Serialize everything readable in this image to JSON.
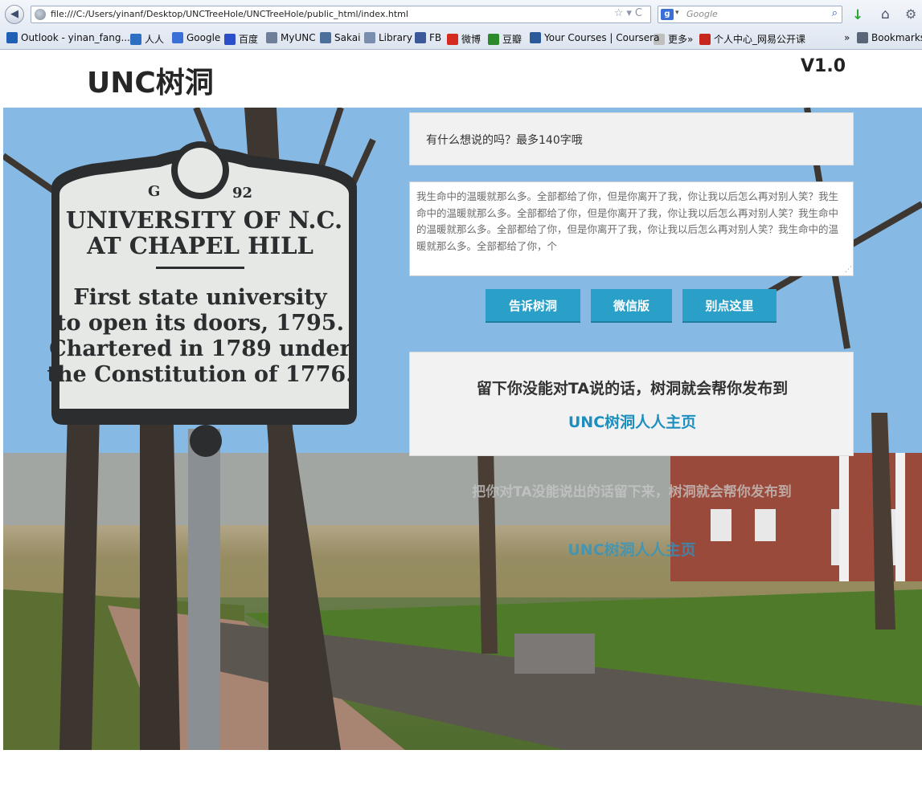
{
  "browser": {
    "back_glyph": "◀",
    "url": "file:///C:/Users/yinanf/Desktop/UNCTreeHole/UNCTreeHole/public_html/index.html",
    "url_icons": "☆▾C",
    "search_engine_glyph": "g",
    "search_drop_glyph": "▾",
    "search_placeholder": "Google",
    "search_glyph": "⌕",
    "download_glyph": "↓",
    "home_glyph": "⌂",
    "addon_glyph": "⚙",
    "bookmarks": [
      {
        "label": "Outlook - yinan_fang...",
        "icon": "outlook-icon",
        "color": "#1f5fb4"
      },
      {
        "label": "人人",
        "icon": "renren-icon",
        "color": "#2d6fc0"
      },
      {
        "label": "Google",
        "icon": "google-icon",
        "color": "#3b6fd8"
      },
      {
        "label": "百度",
        "icon": "baidu-icon",
        "color": "#2a4fc8"
      },
      {
        "label": "MyUNC",
        "icon": "myunc-icon",
        "color": "#6e7f9a"
      },
      {
        "label": "Sakai",
        "icon": "sakai-icon",
        "color": "#4c6f9c"
      },
      {
        "label": "Library",
        "icon": "library-icon",
        "color": "#7a8fb0"
      },
      {
        "label": "FB",
        "icon": "facebook-icon",
        "color": "#3b5998"
      },
      {
        "label": "微博",
        "icon": "weibo-icon",
        "color": "#d52b1e"
      },
      {
        "label": "豆瓣",
        "icon": "douban-icon",
        "color": "#2d8a2a"
      },
      {
        "label": "Your Courses | Coursera",
        "icon": "coursera-icon",
        "color": "#2a5a9a"
      },
      {
        "label": "更多»",
        "icon": "folder-icon",
        "color": "#bfbfbf"
      },
      {
        "label": "个人中心_网易公开课",
        "icon": "netease-icon",
        "color": "#c8261c"
      }
    ],
    "overflow_label": "»",
    "bookmarks_menu_label": "Bookmarks"
  },
  "site": {
    "title": "UNC树洞",
    "version": "V1.0"
  },
  "form": {
    "prompt": "有什么想说的吗？最多140字哦",
    "message": "我生命中的温暖就那么多。全部都给了你，但是你离开了我，你让我以后怎么再对别人笑？我生命中的温暖就那么多。全部都给了你，但是你离开了我，你让我以后怎么再对别人笑？我生命中的温暖就那么多。全部都给了你，但是你离开了我，你让我以后怎么再对别人笑？我生命中的温暖就那么多。全部都给了你，个",
    "buttons": {
      "submit": "告诉树洞",
      "wechat": "微信版",
      "dont_click": "别点这里"
    },
    "resize_glyph": "⋰"
  },
  "info": {
    "line1": "留下你没能对TA说的话，树洞就会帮你发布到",
    "line2": "UNC树洞人人主页"
  },
  "ghost": {
    "line1": "把你对TA没能说出的话留下来，树洞就会帮你发布到",
    "line2": "UNC树洞人人主页"
  },
  "colors": {
    "accent": "#2aa0c9",
    "link": "#1d8fbf"
  }
}
